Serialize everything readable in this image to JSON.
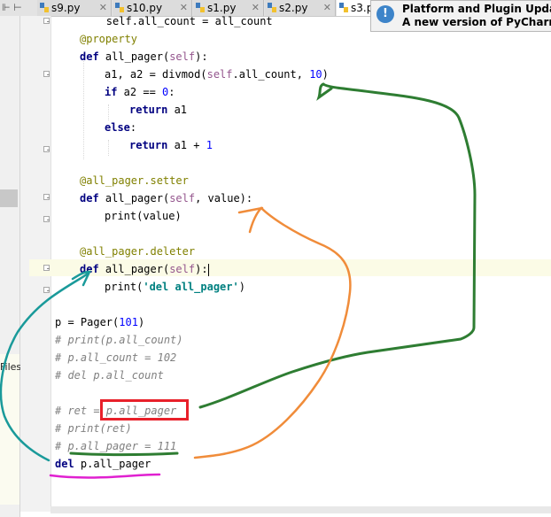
{
  "tabs": [
    {
      "label": "s9.py"
    },
    {
      "label": "s10.py"
    },
    {
      "label": "s1.py"
    },
    {
      "label": "s2.py"
    },
    {
      "label": "s3.p"
    }
  ],
  "left_panel": {
    "tab_hint": "⊩ ⊢",
    "label": "Files"
  },
  "code_lines": [
    {
      "indent": "        ",
      "text": "self.all_count = all_count"
    },
    {
      "indent": "    ",
      "text": "@property"
    },
    {
      "kw": "def",
      "name": "all_pager",
      "self": "self"
    },
    {
      "a1": "a1, a2 = divmod(",
      "self": "self",
      "rest": ".all_count, ",
      "num": "10",
      "close": ")"
    },
    {
      "kw": "if",
      "rest": " a2 == ",
      "num": "0",
      "close": ":"
    },
    {
      "kw": "return",
      "rest": " a1"
    },
    {
      "kw": "else",
      "close": ":"
    },
    {
      "kw": "return",
      "rest": " a1 + ",
      "num": "1"
    },
    {
      "deco": "@all_pager.setter"
    },
    {
      "kw": "def",
      "name": "all_pager",
      "self": "self",
      "args": ", value):"
    },
    {
      "rest": "print(value)"
    },
    {
      "deco": "@all_pager.deleter"
    },
    {
      "kw": "def",
      "name": "all_pager",
      "self": "self"
    },
    {
      "rest": "print(",
      "str": "'del all_pager'",
      "close": ")"
    },
    {
      "rest": "p = Pager(",
      "num": "101",
      "close": ")"
    },
    {
      "cm": "# print(p.all_count)"
    },
    {
      "cm": "# p.all_count = 102"
    },
    {
      "cm": "# del p.all_count"
    },
    {
      "cm": "# ret = p.all_pager"
    },
    {
      "cm": "# print(ret)"
    },
    {
      "cm": "# p.all_pager = 111"
    },
    {
      "kw": "del",
      "rest": " p.all_pager"
    }
  ],
  "notification": {
    "title": "Platform and Plugin Update",
    "text": "A new version of PyCharm i",
    "icon": "info-icon"
  },
  "annotation_colors": {
    "green": "#2e7d32",
    "orange": "#f08c3a",
    "teal": "#1a9a9a",
    "magenta": "#e020d0",
    "red": "#e8202a"
  }
}
